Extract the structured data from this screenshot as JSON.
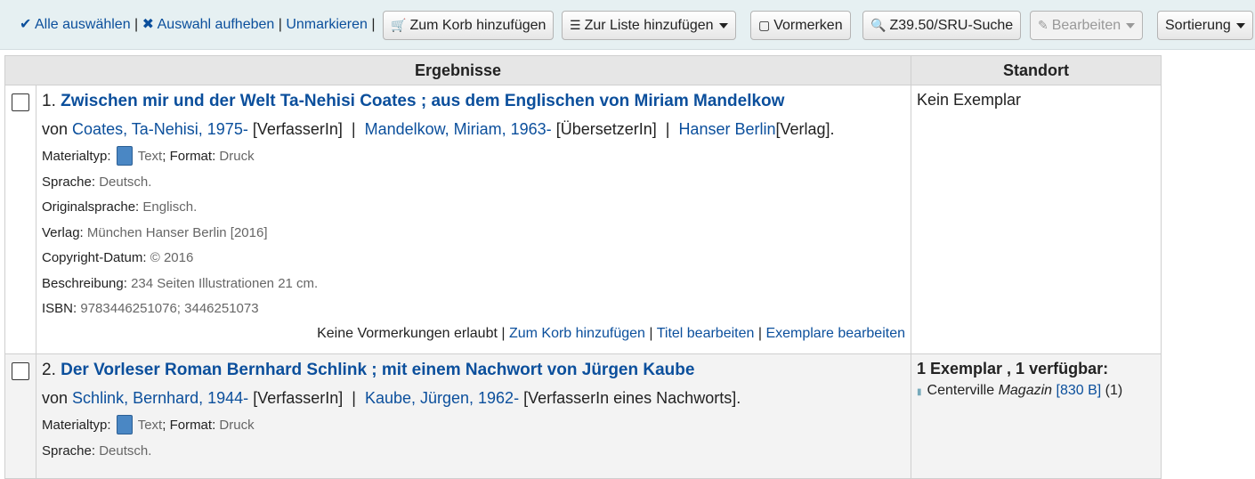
{
  "toolbar": {
    "select_all": "Alle auswählen",
    "clear_all": "Auswahl aufheben",
    "unmark": "Unmarkieren",
    "add_to_cart": "Zum Korb hinzufügen",
    "add_to_list": "Zur Liste hinzufügen",
    "place_hold": "Vormerken",
    "z3950": "Z39.50/SRU-Suche",
    "edit": "Bearbeiten",
    "sort": "Sortierung"
  },
  "table": {
    "header_results": "Ergebnisse",
    "header_location": "Standort"
  },
  "results": [
    {
      "number": "1.",
      "title": "Zwischen mir und der Welt Ta-Nehisi Coates ; aus dem Englischen von Miriam Mandelkow",
      "by": "von",
      "author1": "Coates, Ta-Nehisi, 1975-",
      "role1": "[VerfasserIn]",
      "author2": "Mandelkow, Miriam, 1963-",
      "role2": "[ÜbersetzerIn]",
      "author3": "Hanser Berlin",
      "role3": "[Verlag].",
      "material_label": "Materialtyp:",
      "material_value": "Text",
      "format_label": "Format:",
      "format_value": "Druck",
      "language_label": "Sprache:",
      "language_value": "Deutsch.",
      "orig_language_label": "Originalsprache:",
      "orig_language_value": "Englisch.",
      "publisher_label": "Verlag:",
      "publisher_value": "München Hanser Berlin [2016]",
      "copyright_label": "Copyright-Datum:",
      "copyright_value": "© 2016",
      "description_label": "Beschreibung:",
      "description_value": "234 Seiten Illustrationen 21 cm.",
      "isbn_label": "ISBN:",
      "isbn_value": "9783446251076; 3446251073",
      "no_holds": "Keine Vormerkungen erlaubt",
      "action_cart": "Zum Korb hinzufügen",
      "action_edit_title": "Titel bearbeiten",
      "action_edit_items": "Exemplare bearbeiten",
      "location": "Kein Exemplar"
    },
    {
      "number": "2.",
      "title": "Der Vorleser Roman Bernhard Schlink ; mit einem Nachwort von Jürgen Kaube",
      "by": "von",
      "author1": "Schlink, Bernhard, 1944-",
      "role1": "[VerfasserIn]",
      "author2": "Kaube, Jürgen, 1962-",
      "role2": "[VerfasserIn eines Nachworts].",
      "material_label": "Materialtyp:",
      "material_value": "Text",
      "format_label": "Format:",
      "format_value": "Druck",
      "language_label": "Sprache:",
      "language_value": "Deutsch.",
      "availability": "1 Exemplar , 1 verfügbar:",
      "branch": "Centerville",
      "shelving": "Magazin",
      "callnumber": "[830 B]",
      "count": "(1)"
    }
  ]
}
